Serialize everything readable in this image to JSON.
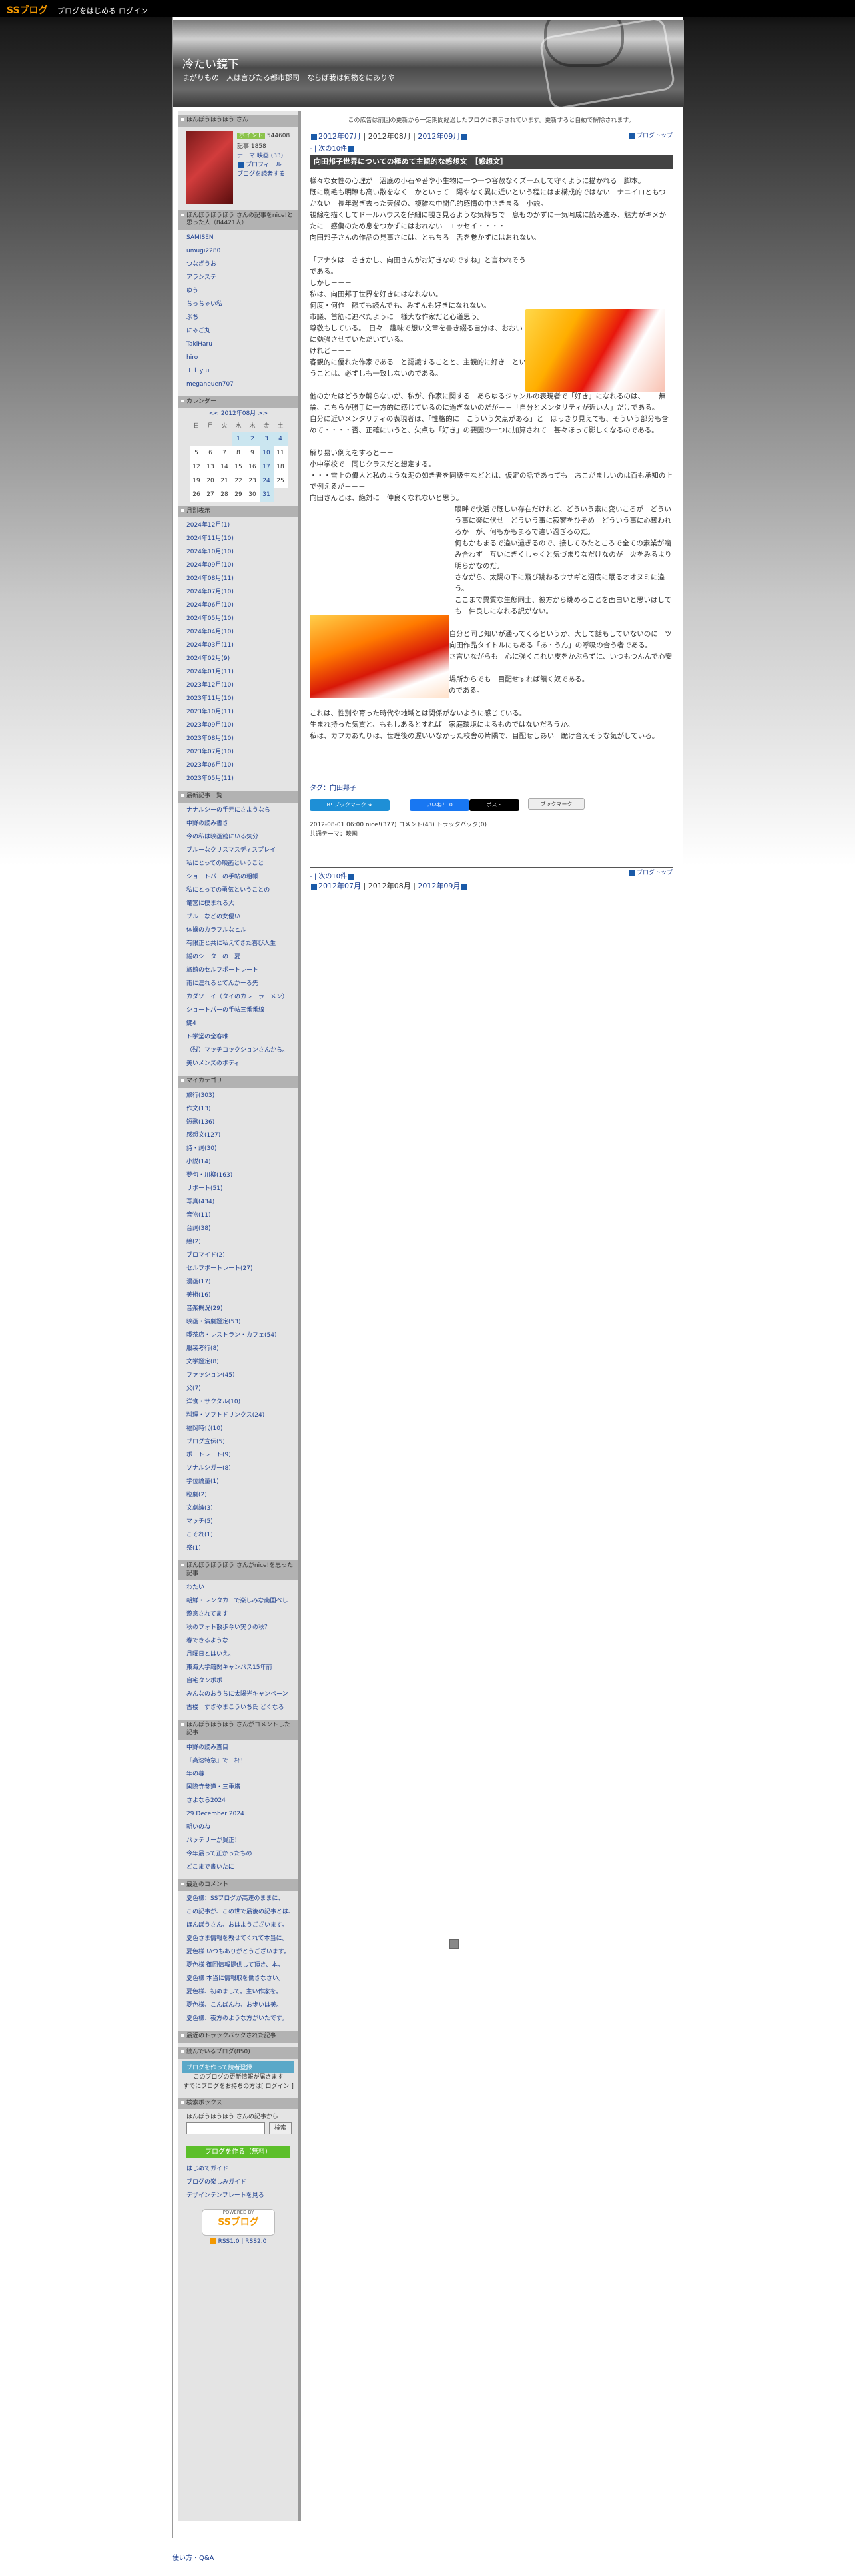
{
  "topbar": {
    "logo": "SSブログ",
    "link1": "ブログをはじめる",
    "link2": "ログイン"
  },
  "header": {
    "title": "冷たい鏡下",
    "desc": "まがりもの　人は言びたる都市郡司　ならば我は何物をにありや"
  },
  "profile": {
    "heading": "ほんぽうほうほう さん",
    "points_label": "ポイント",
    "points": "544608",
    "count": "記事 1858",
    "theme": "テーマ 映画 (33)",
    "prof_link": "プロフィール",
    "reader_link": "ブログを読者する"
  },
  "nice": {
    "heading": "ほんぽうほうほう さんの記事をnice!と思った人（84421人）",
    "items": [
      "SAMISEN",
      "umugi2280",
      "つなぎうお",
      "アラシステ",
      "ゆう",
      "ちっちゃい私",
      "ぷち",
      "にゃご丸",
      "TakiHaru",
      "hiro",
      "１ｌｙｕ",
      "meganeuen707"
    ]
  },
  "calendar": {
    "heading": "カレンダー",
    "month": "<< 2012年08月 >>",
    "days": [
      "日",
      "月",
      "火",
      "水",
      "木",
      "金",
      "土"
    ],
    "rows": [
      [
        "",
        "",
        "",
        "1",
        "2",
        "3",
        "4"
      ],
      [
        "5",
        "6",
        "7",
        "8",
        "9",
        "10",
        "11"
      ],
      [
        "12",
        "13",
        "14",
        "15",
        "16",
        "17",
        "18"
      ],
      [
        "19",
        "20",
        "21",
        "22",
        "23",
        "24",
        "25"
      ],
      [
        "26",
        "27",
        "28",
        "29",
        "30",
        "31",
        ""
      ]
    ]
  },
  "archive": {
    "heading": "月別表示",
    "items": [
      "2024年12月(1)",
      "2024年11月(10)",
      "2024年10月(10)",
      "2024年09月(10)",
      "2024年08月(11)",
      "2024年07月(10)",
      "2024年06月(10)",
      "2024年05月(10)",
      "2024年04月(10)",
      "2024年03月(11)",
      "2024年02月(9)",
      "2024年01月(11)",
      "2023年12月(10)",
      "2023年11月(10)",
      "2023年10月(11)",
      "2023年09月(10)",
      "2023年08月(10)",
      "2023年07月(10)",
      "2023年06月(10)",
      "2023年05月(11)"
    ]
  },
  "recent": {
    "heading": "最新記事一覧",
    "items": [
      "ナナルシーの手元にさようなら",
      "中野の読み書き",
      "今の私は映画館にいる気分",
      "ブルーなクリスマスディスプレイ",
      "私にとっての映画ということ",
      "ショートパーの手帖の粗帳",
      "私にとっての勇気ということの",
      "竜宮に棲まれる大",
      "ブルーなどの女優い",
      "体操のカラフルなヒル",
      "有限正と共に私えてきた喜び人生",
      "謡のシーターのー夏",
      "旅館のセルフポートレート",
      "雨に濡れるとてんかーる先",
      "カダソーイ（タイのカレーラーメン）",
      "ショートパーの手帖三番番線",
      "鍵4",
      "ト学堂の全客唯",
      "（残）マッチコックションさんから。",
      "美いメンズのボディ"
    ]
  },
  "category": {
    "heading": "マイカテゴリー",
    "items": [
      "旅行(303)",
      "作文(13)",
      "短歌(136)",
      "感想文(127)",
      "詩・詞(30)",
      "小説(14)",
      "夢句・川柳(163)",
      "リポート(51)",
      "写真(434)",
      "音物(11)",
      "台詞(38)",
      "絵(2)",
      "ブロマイド(2)",
      "セルフポートレート(27)",
      "漫画(17)",
      "美術(16)",
      "音楽概況(29)",
      "映画・演劇鑑定(53)",
      "喫茶店・レストラン・カフェ(54)",
      "服装考行(8)",
      "文学鑑定(8)",
      "ファッション(45)",
      "父(7)",
      "洋食・サクタル(10)",
      "料理・ソフトドリンクス(24)",
      "福岡時代(10)",
      "ブログ宣伝(5)",
      "ポートレート(9)",
      "ソナルシガー(8)",
      "学位論量(1)",
      "臨劇(2)",
      "文劇論(3)",
      "マッチ(5)",
      "こそれ(1)",
      "祭(1)"
    ]
  },
  "niced": {
    "heading": "ほんぽうほうほう さんがnice!を思った記事",
    "items": [
      "わたい",
      "朝鮮・レンタカーで楽しみな南国ベし",
      "遊意されてます",
      "秋のフォト散歩今い実りの秋？",
      "春できるような",
      "月曜日とはいえ。",
      "東海大学籍関キャンパス15年前",
      "自宅タンポポ",
      "みんなのおうちに太陽光キャンペーン",
      "古楼　すぎやまこういち氏 どくなる"
    ]
  },
  "commented": {
    "heading": "ほんぽうほうほう さんがコメントした記事",
    "items": [
      "中野の読み直目",
      "『高速特急』で一杯！",
      "年の暮",
      "国際寺参道・三重塔",
      "さよなら2024",
      "29 December 2024",
      "朝いのね",
      "パッテリーが買正！",
      "今年最って正かったもの",
      "どこまで書いたに"
    ]
  },
  "comments": {
    "heading": "最近のコメント",
    "items": [
      "夏色様：SSブログが高速のままに、",
      "この記事が、この世で最後の記事とは、",
      "ほんぽうさん、おはようございます。",
      "夏色さま情報を教せてくれて本当に。",
      "夏色様 いつもありがとうございます。",
      "夏色様 御回情報提供して頂き、本。",
      "夏色様 本当に情報取を働きなさい。",
      "夏色様、初めまして。主い作家を。",
      "夏色様、こんばんわ、お歩いは美。",
      "夏色様、夜方のような方がいたです。"
    ]
  },
  "tb": {
    "heading": "最近のトラックバックされた記事"
  },
  "reading": {
    "heading": "読んでいるブログ(850)"
  },
  "create": {
    "label": "ブログを作って読者登録",
    "note1": "このブログの更新情報が届きます",
    "note2": "すでにブログをお持ちの方は[ ログイン ]"
  },
  "search": {
    "heading": "検索ボックス",
    "label": "ほんぽうほうほう さんの記事から",
    "button": "検索"
  },
  "side_foot": {
    "create_btn": "ブログを作る（無料）",
    "guide1": "はじめてガイド",
    "guide2": "ブログの楽しみガイド",
    "guide3": "デザインテンプレートを見る",
    "powered": "POWERED BY",
    "brand": "SSブログ",
    "rss": "RSS1.0 | RSS2.0"
  },
  "main": {
    "notice": "この広告は前回の更新から一定期間経過したブログに表示されています。更新すると自動で解除されます。",
    "prev": "2012年07月",
    "cur": "2012年08月",
    "next": "2012年09月",
    "top": "ブログトップ",
    "pager": "- | 次の10件",
    "entry_title": "向田邦子世界についての極めて主観的な感想文　［感想文］",
    "para1": [
      "様々な女性の心理が　沼底の小石や苔や小生物に一つ一つ容赦なくズームして守くように描かれる　脚本。",
      "既に刷毛も明瞭も高い散をなく　かといって　陽やなく異に近いという程にはま構成的ではない　ナニイロともつかない　長年過ぎ去った天候の、複雑な中間色的感情の中さきまる　小説。",
      "視線を描くしてドールハウスを仔細に覗き見るような気持ちで　息ものかずに一気呵成に読み進み、魅力がキメかたに　感傷のため息をつかずにはおれない　エッセイ・・・・",
      "向田邦子さんの作品の見事さには、ともちろ　舌を巻かずにはおれない。"
    ],
    "para2": [
      "「アナタは　さきかし、向田さんがお好きなのですね」と言われそうである。",
      "しかし－－－",
      "私は、向田邦子世界を好きにはなれない。",
      "何度・何作　観ても読んでも、みずんも好きになれない。",
      "市議、首筋に迫べたように　様大な作家だと心道思う。",
      "尊敬もしている。　日々　趣味で想い文章を書き綴る自分は、おおいに勉強させていただいている。",
      "けれど－－－",
      "客観的に優れた作家である　と認識することと、主観的に好き　ということは、必ずしも一致しないのである。"
    ],
    "para3": [
      "他のかたはどうか解らないが、私が、作家に関する　あらゆるジャンルの表現者で「好き」になれるのは、－－無論、こちらが勝手に一方的に感じているのに過ぎないのだが－－「自分とメンタリティが近い人」だけである。",
      "自分に近いメンタリティの表現者は、「性格的に　こういう欠点がある」と　ほっきり見えても、そういう部分も含めて・・・・否、正確にいうと、欠点も「好き」の要因の一つに加算されて　甚々ほって影しくなるのである。"
    ],
    "para4": [
      "解り易い例えをすると－－",
      "小中学校で　同じクラスだと想定する。",
      "・・・雪上の偉人と私のような泥の如き者を同級生などとは、仮定の話であっても　おこがましいのは百も承知の上で例えるが－－－",
      "向田さんとは、絶対に　仲良くなれないと思う。"
    ],
    "para5": [
      "眼畔で快活で既しい存在だけれど、どういう素に変いころが　どういう事に楽に伏せ　どういう事に寂寥をひそめ　どういう事に心奪われるか　が、何もかもまるで違い過ぎるのだ。",
      "何もかもまるで違い過ぎるので、接してみたところで全ての素業が噛み合わず　互いにぎくしゃくと気づまりなだけなのが　火をみるより明らかなのだ。",
      "さながら、太陽の下に飛び跳ねるウサギと沼底に眠るオオヌミに違う。",
      "ここまで異質な生態同士、彼方から眺めることを面白いと思いはしても　仲良しになれる訳がない。"
    ],
    "para6": [
      "仲良しになれる奴というのは、なんとなく　自分と同じ知いが通ってくるというか、大して話もしていないのに　ツーカーのところがあるというか、－－そう、向田作品タイトルにもある「あ・うん」の呼吸の合う者である。",
      "「まったく　しょうもない奴だ」と　ぶつくさ言いながらも　心に強くこれい皮をかぶらずに、いつもつんんで心安くら居である。",
      "あるいは、真はわかずとも、ちょっと離れた場所からでも　目配せすれば頷く奴である。",
      "つまり、メンタリティが近い人に他ならないのである。"
    ],
    "para7": [
      "これは、性別や育った時代や地域とは関係がないように感じている。",
      "生まれ持った気質と、ももしあるとすれば　家庭環境によるものではないだろうか。",
      "私は、カフカあたりは、世理後の遅いいなかった校舎の片隅で、目配せしあい　跪け合えそうな気がしている。"
    ],
    "tag": "タグ：向田邦子",
    "btn_hatena": "B! ブックマーク ★",
    "btn_like": "いいね！ 0",
    "btn_post": "ポスト",
    "btn_bookmark": "ブックマーク",
    "meta": "2012-08-01 06:00  nice!(377)  コメント(43)  トラックバック(0)",
    "meta2": "共通テーマ：映画",
    "pager2": "- | 次の10件"
  },
  "bottom": {
    "link": "使い方・Q&A"
  },
  "colors": {
    "link": "#1a3d8f",
    "header_bg": "#444444",
    "accent": "#1a5aa8"
  },
  "icons": [
    "square-nav-icon",
    "rss-icon",
    "glass-image"
  ]
}
